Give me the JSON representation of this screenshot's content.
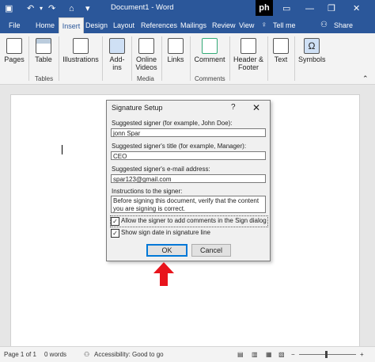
{
  "titlebar": {
    "doc_title": "Document1 - Word",
    "logo_text": "ph",
    "icons": [
      "save-icon",
      "undo-icon",
      "redo-icon",
      "home-icon",
      "customize-icon",
      "minimize-icon",
      "restore-icon",
      "close-icon"
    ]
  },
  "tabs": [
    "File",
    "Home",
    "Insert",
    "Design",
    "Layout",
    "References",
    "Mailings",
    "Review",
    "View",
    "Tell me",
    "Share"
  ],
  "ribbon": {
    "pages": "Pages",
    "table": "Table",
    "tables_group": "Tables",
    "illustrations": "Illustrations",
    "addins": "Add-ins",
    "online_videos_1": "Online",
    "online_videos_2": "Videos",
    "media_group": "Media",
    "links": "Links",
    "comment": "Comment",
    "comments_group": "Comments",
    "header_footer_1": "Header &",
    "header_footer_2": "Footer",
    "text": "Text",
    "symbols": "Symbols"
  },
  "dialog": {
    "title": "Signature Setup",
    "help": "?",
    "close": "✕",
    "signer_label": "Suggested signer (for example, John Doe):",
    "signer_value": "jonn Spar",
    "title_label": "Suggested signer's title (for example, Manager):",
    "title_value": "CEO",
    "email_label": "Suggested signer's e-mail address:",
    "email_value": "spar123@gmail.com",
    "instructions_label": "Instructions to the signer:",
    "instructions_value": "Before signing this document, verify that the content you are signing is correct.",
    "allow_comments_label": "Allow the signer to add comments in the Sign dialog",
    "allow_comments_checked": true,
    "show_date_label": "Show sign date in signature line",
    "show_date_checked": true,
    "ok_label": "OK",
    "cancel_label": "Cancel"
  },
  "status": {
    "page": "Page 1 of 1",
    "words": "0 words",
    "accessibility": "Accessibility: Good to go"
  },
  "colors": {
    "word_blue": "#2b579a",
    "arrow_red": "#e8141c"
  }
}
